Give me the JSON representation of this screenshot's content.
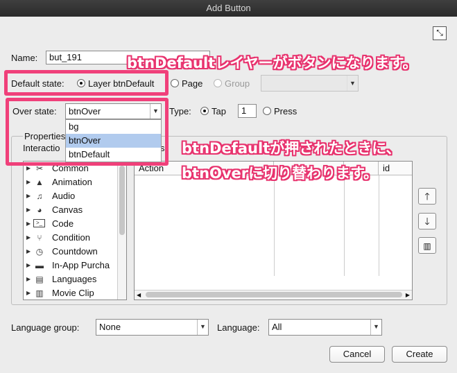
{
  "window": {
    "title": "Add Button"
  },
  "icons": {
    "expand": "expand-icon"
  },
  "name": {
    "label": "Name:",
    "value": "but_191"
  },
  "default_state": {
    "label": "Default state:",
    "options": [
      {
        "label": "Layer btnDefault",
        "selected": true,
        "enabled": true
      },
      {
        "label": "Page",
        "selected": false,
        "enabled": true
      },
      {
        "label": "Group",
        "selected": false,
        "enabled": false
      }
    ]
  },
  "over_state": {
    "label": "Over state:",
    "value": "btnOver",
    "options": [
      "bg",
      "btnOver",
      "btnDefault"
    ],
    "selected_index": 1
  },
  "type": {
    "label": "Type:",
    "tap_label": "Tap",
    "tap_selected": true,
    "count": "1",
    "press_label": "Press"
  },
  "properties": {
    "label": "Properties",
    "interactions_label": "Interactio",
    "hidden_header_fragment": "s",
    "tree": [
      {
        "label": "Common",
        "icon": "tools-icon"
      },
      {
        "label": "Animation",
        "icon": "animation-icon"
      },
      {
        "label": "Audio",
        "icon": "music-note-icon"
      },
      {
        "label": "Canvas",
        "icon": "palette-icon"
      },
      {
        "label": "Code",
        "icon": "terminal-icon"
      },
      {
        "label": "Condition",
        "icon": "condition-icon"
      },
      {
        "label": "Countdown",
        "icon": "clock-icon"
      },
      {
        "label": "In-App Purcha",
        "icon": "cart-icon"
      },
      {
        "label": "Languages",
        "icon": "speech-icon"
      },
      {
        "label": "Movie Clip",
        "icon": "film-icon"
      }
    ],
    "columns": [
      "Action",
      "",
      "",
      "id"
    ]
  },
  "side_buttons": [
    {
      "icon": "arrow-up-icon"
    },
    {
      "icon": "arrow-down-icon"
    },
    {
      "icon": "trash-icon"
    }
  ],
  "language_group": {
    "label": "Language group:",
    "value": "None"
  },
  "language": {
    "label": "Language:",
    "value": "All"
  },
  "buttons": {
    "cancel": "Cancel",
    "create": "Create"
  },
  "annotations": {
    "top": "btnDefaultレイヤーがボタンになります。",
    "middle_line1": "btnDefaultが押されたときに、",
    "middle_line2": "btnOverに切り替わります。"
  },
  "colors": {
    "highlight": "#f0407a",
    "selection": "#b1cbee",
    "titlebar": "#2f2f2f"
  }
}
